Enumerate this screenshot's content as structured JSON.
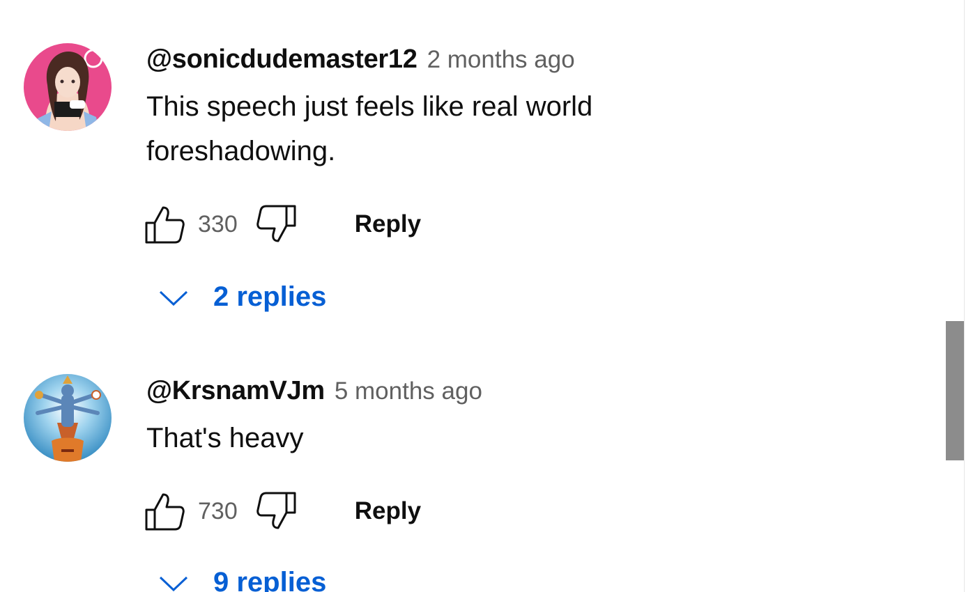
{
  "comments": [
    {
      "author": "@sonicdudemaster12",
      "time": "2 months ago",
      "text": "This speech just feels like real world foreshadowing.",
      "likes": "330",
      "reply_label": "Reply",
      "replies_label": "2 replies",
      "avatar_icon": "anime-character-avatar"
    },
    {
      "author": "@KrsnamVJm",
      "time": "5 months ago",
      "text": "That's heavy",
      "likes": "730",
      "reply_label": "Reply",
      "replies_label": "9 replies",
      "avatar_icon": "deity-illustration-avatar"
    }
  ],
  "colors": {
    "link_blue": "#065fd4",
    "meta_gray": "#606060",
    "text": "#0f0f0f",
    "scrollbar_thumb": "#8c8c8c"
  }
}
